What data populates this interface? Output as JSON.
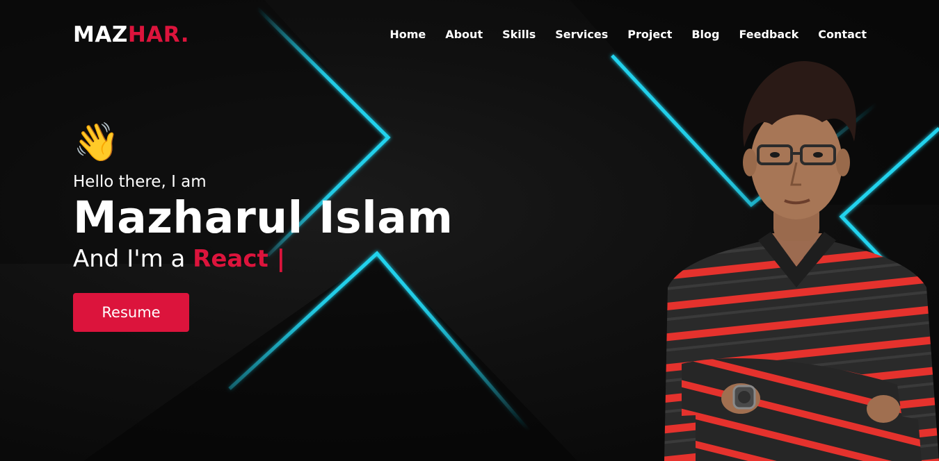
{
  "logo": {
    "part1": "MAZ",
    "part2": "HAR."
  },
  "nav": {
    "items": [
      "Home",
      "About",
      "Skills",
      "Services",
      "Project",
      "Blog",
      "Feedback",
      "Contact"
    ]
  },
  "hero": {
    "wave_emoji": "👋",
    "greeting": "Hello there, I am",
    "name": "Mazharul Islam",
    "role_prefix": "And I'm a ",
    "role_highlight": "React |",
    "button_label": "Resume"
  },
  "colors": {
    "accent": "#dc143c",
    "background": "#0b0b0b",
    "glow": "#22d3ee"
  },
  "icons": {
    "wave": "waving-hand-icon"
  }
}
